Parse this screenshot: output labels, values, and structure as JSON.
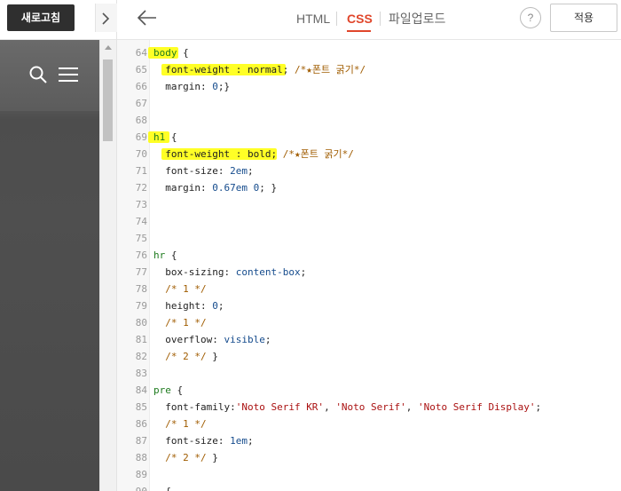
{
  "left_panel": {
    "refresh_label": "새로고침",
    "collapse_icon": "chevron-right-icon",
    "preview_icons": [
      "search-icon",
      "menu-icon"
    ]
  },
  "topbar": {
    "back_icon": "arrow-left-icon",
    "tabs": [
      {
        "label": "HTML",
        "active": false
      },
      {
        "label": "CSS",
        "active": true
      },
      {
        "label": "파일업로드",
        "active": false
      }
    ],
    "help_label": "?",
    "apply_label": "적용",
    "accent_color": "#e0462b"
  },
  "editor": {
    "lines": [
      {
        "n": "64",
        "tokens": [
          {
            "t": "body",
            "c": "sel"
          },
          {
            "t": " {",
            "c": "prop"
          }
        ]
      },
      {
        "n": "65",
        "tokens": [
          {
            "t": "  font-weight : normal;",
            "c": "prop"
          },
          {
            "t": " /*★폰트 굵기*/",
            "c": "cmt"
          }
        ]
      },
      {
        "n": "66",
        "tokens": [
          {
            "t": "  margin: ",
            "c": "prop"
          },
          {
            "t": "0",
            "c": "val"
          },
          {
            "t": ";}",
            "c": "prop"
          }
        ]
      },
      {
        "n": "67",
        "tokens": []
      },
      {
        "n": "68",
        "tokens": []
      },
      {
        "n": "69",
        "tokens": [
          {
            "t": "h1",
            "c": "sel"
          },
          {
            "t": " {",
            "c": "prop"
          }
        ]
      },
      {
        "n": "70",
        "tokens": [
          {
            "t": "  font-weight : bold;",
            "c": "prop"
          },
          {
            "t": " /*★폰트 굵기*/",
            "c": "cmt"
          }
        ]
      },
      {
        "n": "71",
        "tokens": [
          {
            "t": "  font-size: ",
            "c": "prop"
          },
          {
            "t": "2em",
            "c": "val"
          },
          {
            "t": ";",
            "c": "prop"
          }
        ]
      },
      {
        "n": "72",
        "tokens": [
          {
            "t": "  margin: ",
            "c": "prop"
          },
          {
            "t": "0.67em 0",
            "c": "val"
          },
          {
            "t": "; }",
            "c": "prop"
          }
        ]
      },
      {
        "n": "73",
        "tokens": []
      },
      {
        "n": "74",
        "tokens": []
      },
      {
        "n": "75",
        "tokens": []
      },
      {
        "n": "76",
        "tokens": [
          {
            "t": "hr",
            "c": "sel"
          },
          {
            "t": " {",
            "c": "prop"
          }
        ]
      },
      {
        "n": "77",
        "tokens": [
          {
            "t": "  box-sizing: ",
            "c": "prop"
          },
          {
            "t": "content-box",
            "c": "val"
          },
          {
            "t": ";",
            "c": "prop"
          }
        ]
      },
      {
        "n": "78",
        "tokens": [
          {
            "t": "  /* 1 */",
            "c": "cmt"
          }
        ]
      },
      {
        "n": "79",
        "tokens": [
          {
            "t": "  height: ",
            "c": "prop"
          },
          {
            "t": "0",
            "c": "val"
          },
          {
            "t": ";",
            "c": "prop"
          }
        ]
      },
      {
        "n": "80",
        "tokens": [
          {
            "t": "  /* 1 */",
            "c": "cmt"
          }
        ]
      },
      {
        "n": "81",
        "tokens": [
          {
            "t": "  overflow: ",
            "c": "prop"
          },
          {
            "t": "visible",
            "c": "val"
          },
          {
            "t": ";",
            "c": "prop"
          }
        ]
      },
      {
        "n": "82",
        "tokens": [
          {
            "t": "  /* 2 */",
            "c": "cmt"
          },
          {
            "t": " }",
            "c": "prop"
          }
        ]
      },
      {
        "n": "83",
        "tokens": []
      },
      {
        "n": "84",
        "tokens": [
          {
            "t": "pre",
            "c": "sel"
          },
          {
            "t": " {",
            "c": "prop"
          }
        ]
      },
      {
        "n": "85",
        "tokens": [
          {
            "t": "  font-family:",
            "c": "prop"
          },
          {
            "t": "'Noto Serif KR'",
            "c": "str"
          },
          {
            "t": ", ",
            "c": "prop"
          },
          {
            "t": "'Noto Serif'",
            "c": "str"
          },
          {
            "t": ", ",
            "c": "prop"
          },
          {
            "t": "'Noto Serif Display'",
            "c": "str"
          },
          {
            "t": ";",
            "c": "prop"
          }
        ]
      },
      {
        "n": "86",
        "tokens": [
          {
            "t": "  /* 1 */",
            "c": "cmt"
          }
        ]
      },
      {
        "n": "87",
        "tokens": [
          {
            "t": "  font-size: ",
            "c": "prop"
          },
          {
            "t": "1em",
            "c": "val"
          },
          {
            "t": ";",
            "c": "prop"
          }
        ]
      },
      {
        "n": "88",
        "tokens": [
          {
            "t": "  /* 2 */",
            "c": "cmt"
          },
          {
            "t": " }",
            "c": "prop"
          }
        ]
      },
      {
        "n": "89",
        "tokens": []
      },
      {
        "n": "90",
        "tokens": [
          {
            "t": "  {",
            "c": "prop"
          }
        ]
      }
    ],
    "highlight_color": "#ffff00"
  }
}
